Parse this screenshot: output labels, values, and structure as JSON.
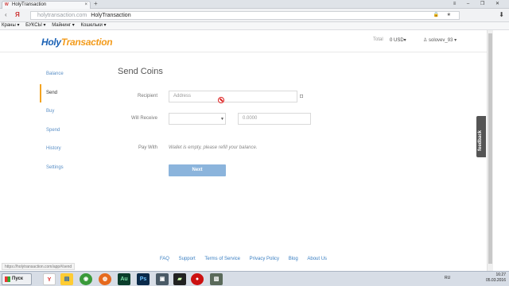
{
  "browser": {
    "tab_title": "HolyTransaction",
    "tab_close": "×",
    "new_tab": "+",
    "window_controls": "≡ – ❐ ✕",
    "nav_back": "‹",
    "nav_yandex": "Я",
    "url_host": "holytransaction.com",
    "url_title": "HolyTransaction",
    "url_icons": "🔒 ★",
    "menu": "⬇",
    "bookmarks": [
      "Краны ▾",
      "БУКСЫ ▾",
      "Майнинг ▾",
      "Кошельки ▾"
    ],
    "status_url": "https://holytransaction.com/app#/send"
  },
  "header": {
    "logo_holy": "Holy",
    "logo_transaction": "Transaction",
    "total_label": "Total",
    "total_amount": "0 USD▾",
    "user": "♙ solovev_93 ▾"
  },
  "sidebar": {
    "items": [
      {
        "label": "Balance"
      },
      {
        "label": "Send"
      },
      {
        "label": "Buy"
      },
      {
        "label": "Spend"
      },
      {
        "label": "History"
      },
      {
        "label": "Settings"
      }
    ]
  },
  "form": {
    "title": "Send Coins",
    "recipient_label": "Recipient",
    "address_placeholder": "Address",
    "will_receive_label": "Will Receive",
    "select_value": "",
    "amount_placeholder": "0.0000",
    "pay_with_label": "Pay With",
    "pay_with_message": "Wallet is empty, please refill your balance.",
    "next_label": "Next"
  },
  "feedback_label": "feedback",
  "footer": {
    "links": [
      "FAQ",
      "Support",
      "Terms of Service",
      "Privacy Policy",
      "Blog",
      "About Us"
    ]
  },
  "taskbar": {
    "start_label": "Пуск",
    "lang": "RU",
    "time": "16:27",
    "date": "05.03.2016"
  }
}
